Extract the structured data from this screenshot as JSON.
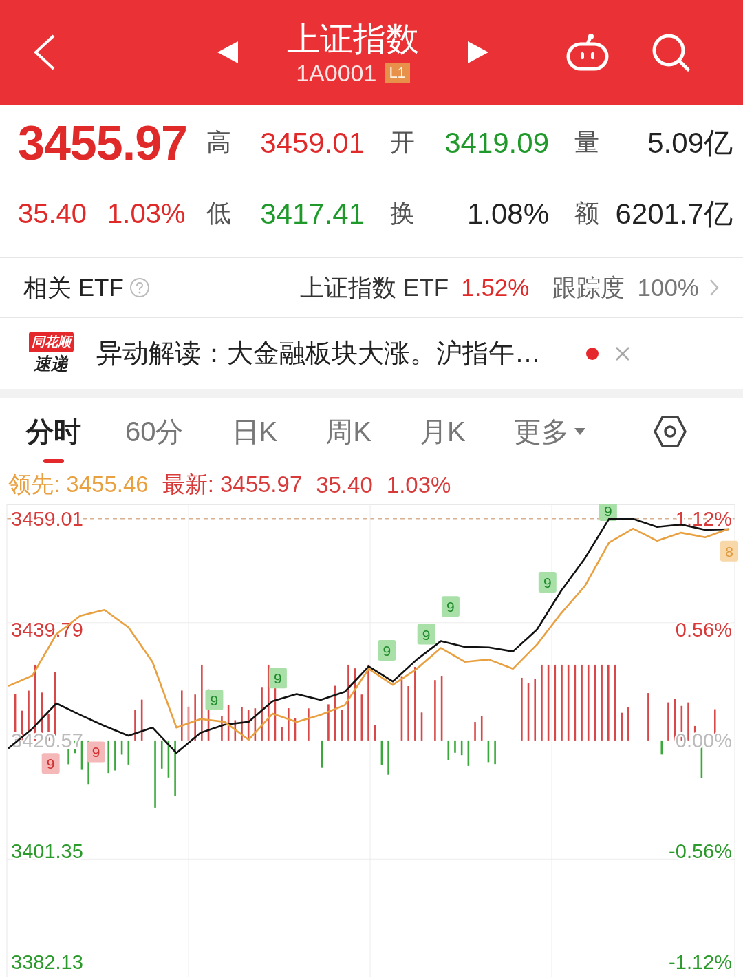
{
  "header": {
    "title": "上证指数",
    "code": "1A0001",
    "level_badge": "L1"
  },
  "quote": {
    "price": "3455.97",
    "change": "35.40",
    "change_pct": "1.03%",
    "color": "#e02a2a",
    "stats": [
      {
        "label": "高",
        "value": "3459.01",
        "color": "#e02a2a"
      },
      {
        "label": "开",
        "value": "3419.09",
        "color": "#1f9a2a"
      },
      {
        "label": "量",
        "value": "5.09亿",
        "color": "#222222"
      },
      {
        "label": "低",
        "value": "3417.41",
        "color": "#1f9a2a"
      },
      {
        "label": "换",
        "value": "1.08%",
        "color": "#222222"
      },
      {
        "label": "额",
        "value": "6201.7亿",
        "color": "#222222"
      }
    ]
  },
  "etf": {
    "label": "相关 ETF",
    "name": "上证指数 ETF",
    "change": "1.52%",
    "tracking_label": "跟踪度",
    "tracking": "100%"
  },
  "news": {
    "logo_top": "同花顺",
    "logo_bottom": "速递",
    "text": "异动解读：大金融板块大涨。沪指午…",
    "unread": true
  },
  "tabs": [
    {
      "label": "分时",
      "selected": true,
      "kind": "tab"
    },
    {
      "label": "60分",
      "selected": false,
      "kind": "tab"
    },
    {
      "label": "日K",
      "selected": false,
      "kind": "tab"
    },
    {
      "label": "周K",
      "selected": false,
      "kind": "tab"
    },
    {
      "label": "月K",
      "selected": false,
      "kind": "tab"
    },
    {
      "label": "更多",
      "selected": false,
      "kind": "menu"
    }
  ],
  "legend": [
    {
      "text": "领先: 3455.46",
      "color": "#e8a040"
    },
    {
      "text": "最新: 3455.97",
      "color": "#d83a3a"
    },
    {
      "text": "35.40",
      "color": "#d83a3a"
    },
    {
      "text": "1.03%",
      "color": "#d83a3a"
    }
  ],
  "right_axis_labels": [
    "1.12%",
    "0.56%",
    "0.00%",
    "-0.56%",
    "-1.12%"
  ],
  "signal_markers": [
    {
      "label": "9",
      "kind": "sell"
    },
    {
      "label": "9",
      "kind": "sell"
    },
    {
      "label": "9",
      "kind": "buy"
    },
    {
      "label": "9",
      "kind": "buy"
    },
    {
      "label": "9",
      "kind": "buy"
    },
    {
      "label": "9",
      "kind": "buy"
    },
    {
      "label": "9",
      "kind": "buy"
    },
    {
      "label": "9",
      "kind": "buy"
    },
    {
      "label": "9",
      "kind": "buy"
    },
    {
      "label": "8",
      "kind": "lead"
    }
  ],
  "chart_data": {
    "type": "line",
    "ylim": [
      3379.5,
      3461.5
    ],
    "categories": [
      null,
      null,
      null,
      null,
      null,
      null,
      null,
      null,
      null,
      null,
      null,
      null,
      null,
      null,
      null,
      null,
      null,
      null,
      null,
      null,
      null,
      null,
      null,
      null,
      null,
      null,
      null,
      null,
      null,
      null,
      null
    ],
    "yticks": [
      {
        "value": 3459.01,
        "label": "3459.01"
      },
      {
        "value": 3439.79,
        "label": "3439.79"
      },
      {
        "value": 3420.57,
        "label": "3420.57"
      },
      {
        "value": 3401.35,
        "label": "3401.35"
      },
      {
        "value": 3382.13,
        "label": "3382.13"
      }
    ],
    "series": [
      {
        "color": "#111111",
        "values": [
          3419.2,
          3422.6,
          3427.0,
          3425.0,
          3423.1,
          3421.4,
          3422.8,
          3418.4,
          3421.9,
          3423.3,
          3423.8,
          3427.4,
          3428.6,
          3427.6,
          3429.0,
          3433.4,
          3430.8,
          3434.6,
          3437.8,
          3436.8,
          3436.7,
          3436.0,
          3439.8,
          3446.5,
          3452.2,
          3459.0,
          3459.0,
          3457.6,
          3458.0,
          3457.1,
          3457.2
        ]
      },
      {
        "color": "#e8a040",
        "values": [
          3430.0,
          3431.8,
          3439.0,
          3442.2,
          3443.2,
          3440.2,
          3434.2,
          3422.8,
          3424.3,
          3423.8,
          3420.7,
          3425.2,
          3423.8,
          3425.0,
          3426.7,
          3433.0,
          3430.2,
          3433.0,
          3436.6,
          3434.2,
          3434.6,
          3433.0,
          3437.2,
          3442.6,
          3447.4,
          3454.9,
          3457.3,
          3455.2,
          3456.6,
          3455.8,
          3457.3
        ]
      }
    ]
  }
}
